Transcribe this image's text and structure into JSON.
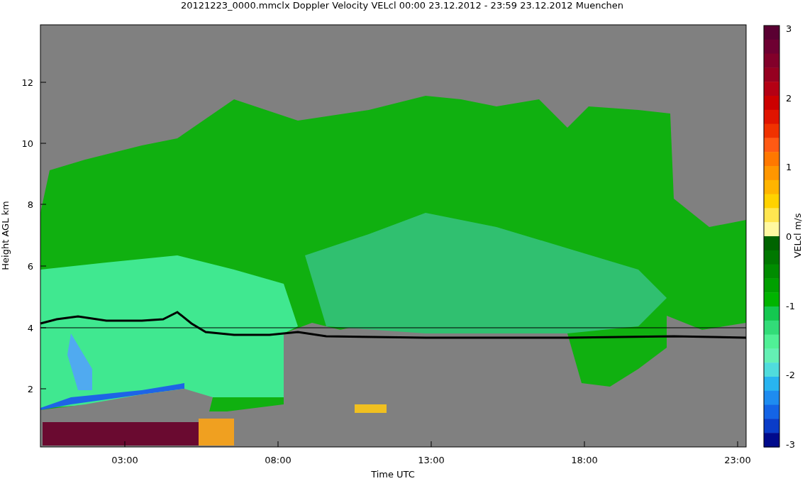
{
  "title": "20121223_0000.mmclx Doppler Velocity VELcl   00:00 23.12.2012 - 23:59 23.12.2012 Muenchen",
  "y_axis": {
    "label": "Height AGL km",
    "ticks": [
      "12",
      "10",
      "8",
      "6",
      "4",
      "2"
    ]
  },
  "x_axis": {
    "label": "Time UTC",
    "ticks": [
      "03:00",
      "08:00",
      "13:00",
      "18:00",
      "23:00"
    ]
  },
  "colorbar": {
    "label": "VELcl m/s",
    "ticks": [
      "3",
      "2",
      "1",
      "0",
      "-1",
      "-2",
      "-3"
    ],
    "segments": [
      {
        "color": "#5a0032"
      },
      {
        "color": "#6e0032"
      },
      {
        "color": "#82002a"
      },
      {
        "color": "#960020"
      },
      {
        "color": "#b40014"
      },
      {
        "color": "#cc0000"
      },
      {
        "color": "#e01400"
      },
      {
        "color": "#f03200"
      },
      {
        "color": "#ff5a14"
      },
      {
        "color": "#ff7800"
      },
      {
        "color": "#ff9600"
      },
      {
        "color": "#ffb400"
      },
      {
        "color": "#ffd200"
      },
      {
        "color": "#ffe650"
      },
      {
        "color": "#fff8a0"
      },
      {
        "color": "#006400"
      },
      {
        "color": "#007800"
      },
      {
        "color": "#008c00"
      },
      {
        "color": "#00a000"
      },
      {
        "color": "#00b400"
      },
      {
        "color": "#14c850"
      },
      {
        "color": "#32dc78"
      },
      {
        "color": "#50f096"
      },
      {
        "color": "#64f0b4"
      },
      {
        "color": "#50dcdc"
      },
      {
        "color": "#28b4f0"
      },
      {
        "color": "#1e8cf0"
      },
      {
        "color": "#1464e6"
      },
      {
        "color": "#0a3cc8"
      },
      {
        "color": "#000a8c"
      }
    ]
  }
}
